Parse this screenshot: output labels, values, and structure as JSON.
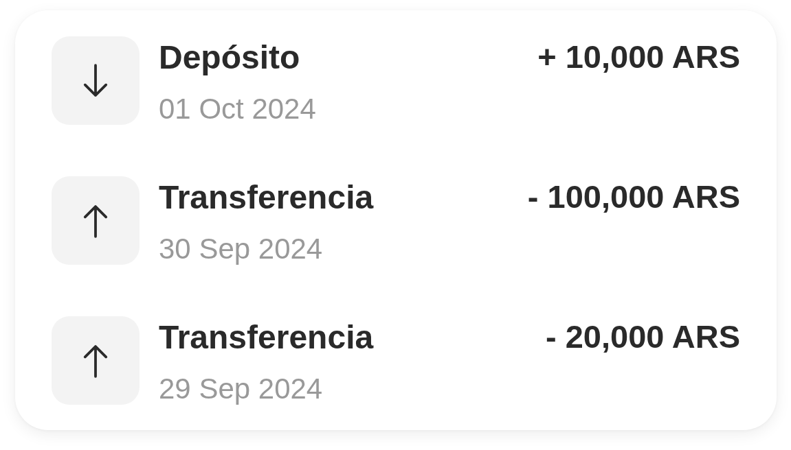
{
  "transactions": [
    {
      "kind": "incoming",
      "title": "Depósito",
      "date": "01 Oct 2024",
      "amount": "+ 10,000 ARS"
    },
    {
      "kind": "outgoing",
      "title": "Transferencia",
      "date": "30 Sep 2024",
      "amount": "- 100,000 ARS"
    },
    {
      "kind": "outgoing",
      "title": "Transferencia",
      "date": "29 Sep 2024",
      "amount": "- 20,000 ARS"
    }
  ]
}
